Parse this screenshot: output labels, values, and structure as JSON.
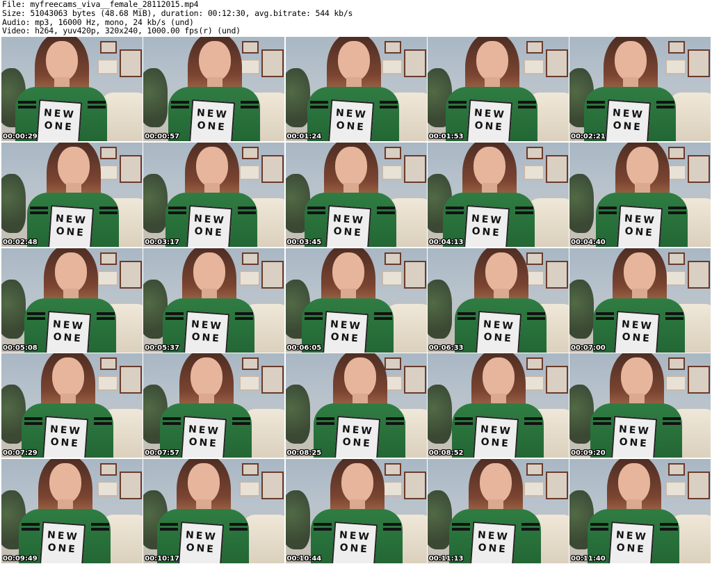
{
  "header": {
    "file_line": "File: myfreecams_viva__female_28112015.mp4",
    "size_line": "Size: 51043063 bytes (48.68 MiB), duration: 00:12:30, avg.bitrate: 544 kb/s",
    "audio_line": "Audio: mp3, 16000 Hz, mono, 24 kb/s (und)",
    "video_line": "Video: h264, yuv420p, 320x240, 1000.00 fps(r) (und)"
  },
  "thumbnails": [
    {
      "time": "00:00:29",
      "print_line1": "NEW",
      "print_line2": "ONE"
    },
    {
      "time": "00:00:57",
      "print_line1": "NEW",
      "print_line2": "ONE"
    },
    {
      "time": "00:01:24",
      "print_line1": "NEW",
      "print_line2": "ONE"
    },
    {
      "time": "00:01:53",
      "print_line1": "NEW",
      "print_line2": "ONE"
    },
    {
      "time": "00:02:21",
      "print_line1": "NEW",
      "print_line2": "ONE"
    },
    {
      "time": "00:02:48",
      "print_line1": "NEW",
      "print_line2": "ONE"
    },
    {
      "time": "00:03:17",
      "print_line1": "NEW",
      "print_line2": "ONE"
    },
    {
      "time": "00:03:45",
      "print_line1": "NEW",
      "print_line2": "ONE"
    },
    {
      "time": "00:04:13",
      "print_line1": "NEW",
      "print_line2": "ONE"
    },
    {
      "time": "00:04:40",
      "print_line1": "NEW",
      "print_line2": "ONE"
    },
    {
      "time": "00:05:08",
      "print_line1": "NEW",
      "print_line2": "ONE"
    },
    {
      "time": "00:05:37",
      "print_line1": "NEW",
      "print_line2": "ONE"
    },
    {
      "time": "00:06:05",
      "print_line1": "NEW",
      "print_line2": "ONE"
    },
    {
      "time": "00:06:33",
      "print_line1": "NEW",
      "print_line2": "ONE"
    },
    {
      "time": "00:07:00",
      "print_line1": "NEW",
      "print_line2": "ONE"
    },
    {
      "time": "00:07:29",
      "print_line1": "NEW",
      "print_line2": "ONE"
    },
    {
      "time": "00:07:57",
      "print_line1": "NEW",
      "print_line2": "ONE"
    },
    {
      "time": "00:08:25",
      "print_line1": "NEW",
      "print_line2": "ONE"
    },
    {
      "time": "00:08:52",
      "print_line1": "NEW",
      "print_line2": "ONE"
    },
    {
      "time": "00:09:20",
      "print_line1": "NEW",
      "print_line2": "ONE"
    },
    {
      "time": "00:09:49",
      "print_line1": "NEW",
      "print_line2": "ONE"
    },
    {
      "time": "00:10:17",
      "print_line1": "NEW",
      "print_line2": "ONE"
    },
    {
      "time": "00:10:44",
      "print_line1": "NEW",
      "print_line2": "ONE"
    },
    {
      "time": "00:11:13",
      "print_line1": "NEW",
      "print_line2": "ONE"
    },
    {
      "time": "00:11:40",
      "print_line1": "NEW",
      "print_line2": "ONE"
    }
  ],
  "colors": {
    "background": "#ffffff",
    "shirt_green": "#2f7d43",
    "timestamp_text": "#ffffff"
  }
}
